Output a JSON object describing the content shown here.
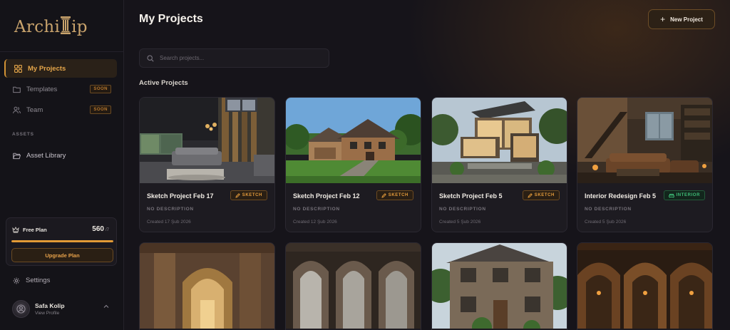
{
  "brand": {
    "logo_text_left": "Archi",
    "logo_text_right": "ip"
  },
  "sidebar": {
    "nav": [
      {
        "label": "My Projects",
        "active": true
      },
      {
        "label": "Templates",
        "badge": "SOON"
      },
      {
        "label": "Team",
        "badge": "SOON"
      }
    ],
    "assets_label": "ASSETS",
    "asset_library": "Asset Library",
    "plan": {
      "name": "Free Plan",
      "credits": "560",
      "credits_suffix": "/7",
      "progress": 1.0,
      "upgrade_label": "Upgrade Plan"
    },
    "settings_label": "Settings",
    "profile": {
      "name": "Safa Kolip",
      "sub": "View Profile"
    }
  },
  "main": {
    "title": "My Projects",
    "new_project_label": "New Project",
    "search_placeholder": "Search projects...",
    "section_title": "Active Projects",
    "projects": [
      {
        "title": "Sketch Project Feb 17",
        "badge": "SKETCH",
        "desc": "NO DESCRIPTION",
        "date": "Created 17 Şub 2026"
      },
      {
        "title": "Sketch Project Feb 12",
        "badge": "SKETCH",
        "desc": "NO DESCRIPTION",
        "date": "Created 12 Şub 2026"
      },
      {
        "title": "Sketch Project Feb 5",
        "badge": "SKETCH",
        "desc": "NO DESCRIPTION",
        "date": "Created 5 Şub 2026"
      },
      {
        "title": "Interior Redesign Feb 5",
        "badge": "INTERIOR",
        "desc": "NO DESCRIPTION",
        "date": "Created 5 Şub 2026"
      }
    ]
  },
  "colors": {
    "accent": "#e29a36",
    "interior": "#3fbf78",
    "background": "#16141a"
  }
}
